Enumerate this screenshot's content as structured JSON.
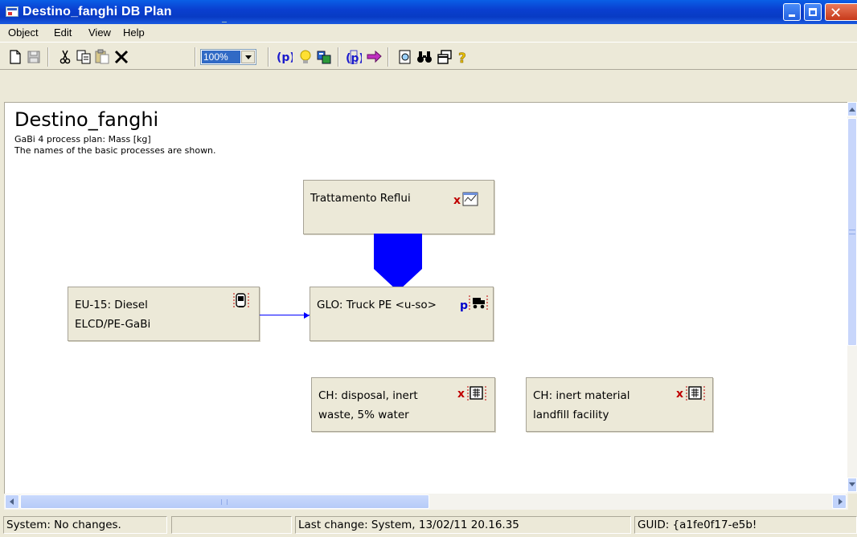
{
  "window": {
    "title": "Destino_fanghi  DB Plan",
    "accent": "#0a3fd0"
  },
  "menu": {
    "items": [
      "Object",
      "Edit",
      "View",
      "Help"
    ]
  },
  "toolbar": {
    "icons": [
      "new-icon",
      "save-icon",
      "cut-icon",
      "copy-icon",
      "paste-icon",
      "delete-icon",
      "process-icon",
      "lightbulb-icon",
      "db-icon",
      "parameter-icon",
      "flow-arrow-icon",
      "preview-icon",
      "binoculars-icon",
      "windows-icon",
      "help-icon"
    ],
    "zoom": "100%"
  },
  "plan": {
    "title": "Destino_fanghi",
    "subtitle": "GaBi 4 process plan: Mass [kg]",
    "note": "The names of the basic processes are shown.",
    "processes": [
      {
        "id": "trattamento",
        "line1": "Trattamento Reflui",
        "line2": "",
        "icon": "x-report-icon"
      },
      {
        "id": "diesel",
        "line1": "EU-15: Diesel",
        "line2": "ELCD/PE-GaBi",
        "icon": "pump-icon"
      },
      {
        "id": "truck",
        "line1": "GLO: Truck PE <u-so>",
        "line2": "",
        "icon": "p-truck-icon"
      },
      {
        "id": "disposal",
        "line1": "CH: disposal, inert",
        "line2": "waste, 5% water",
        "icon": "x-grid-icon"
      },
      {
        "id": "landfill",
        "line1": "CH: inert material",
        "line2": "landfill facility",
        "icon": "x-grid-icon"
      }
    ],
    "flow_color": "#0000ff"
  },
  "status": {
    "system": "System: No changes.",
    "blank": "",
    "last_change": "Last change: System, 13/02/11 20.16.35",
    "guid": "GUID: {a1fe0f17-e5b!"
  }
}
